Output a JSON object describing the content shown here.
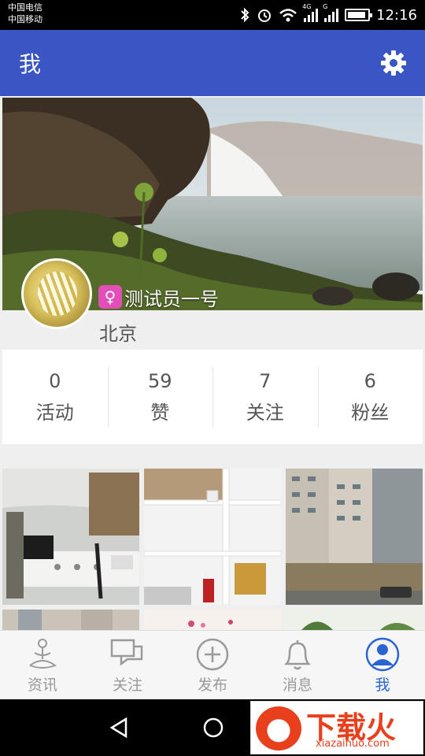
{
  "status_bar": {
    "carrier_1": "中国电信",
    "carrier_2": "中国移动",
    "network_1": "4G",
    "network_2": "G",
    "time": "12:16"
  },
  "app_bar": {
    "title": "我",
    "settings_icon": "gear-icon"
  },
  "profile": {
    "nickname": "测试员一号",
    "location": "北京",
    "gender_icon": "female-icon",
    "gender_glyph": "♀"
  },
  "stats": [
    {
      "value": "0",
      "label": "活动"
    },
    {
      "value": "59",
      "label": "赞"
    },
    {
      "value": "7",
      "label": "关注"
    },
    {
      "value": "6",
      "label": "粉丝"
    }
  ],
  "bottom_nav": [
    {
      "label": "资讯",
      "icon": "meditation-icon",
      "active": false
    },
    {
      "label": "关注",
      "icon": "chat-bubbles-icon",
      "active": false
    },
    {
      "label": "发布",
      "icon": "plus-circle-icon",
      "active": false
    },
    {
      "label": "消息",
      "icon": "bell-icon",
      "active": false
    },
    {
      "label": "我",
      "icon": "user-icon",
      "active": true
    }
  ],
  "watermark": {
    "brand": "下载火",
    "domain": "xiazaihuo.com"
  },
  "colors": {
    "accent": "#3a56c4",
    "active_tab": "#2a64d2",
    "gender_badge": "#e24fb9",
    "watermark": "#e8401c"
  }
}
